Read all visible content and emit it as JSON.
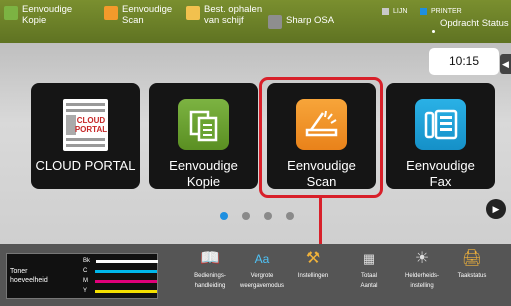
{
  "topbar": {
    "items": [
      {
        "label_l1": "Eenvoudige",
        "label_l2": "Kopie",
        "color": "#7cb342"
      },
      {
        "label_l1": "Eenvoudige",
        "label_l2": "Scan",
        "color": "#f39a2b"
      },
      {
        "label_l1": "Best. ophalen",
        "label_l2": "van schijf",
        "color": "#f2c14e"
      },
      {
        "label_l1": "Sharp OSA",
        "label_l2": "",
        "color": "#8e8e8e"
      }
    ],
    "lijn": "LIJN",
    "printer": "PRINTER",
    "job_status": "Opdracht Status",
    "lijn_color": "#c8c8c8",
    "printer_color": "#1e8fe0"
  },
  "clock": "10:15",
  "tiles": [
    {
      "label_l1": "CLOUD PORTAL",
      "label_l2": "",
      "icon": "cloud-portal-icon",
      "icon_text_l1": "CLOUD",
      "icon_text_l2": "PORTAL"
    },
    {
      "label_l1": "Eenvoudige",
      "label_l2": "Kopie",
      "icon": "copy-icon"
    },
    {
      "label_l1": "Eenvoudige",
      "label_l2": "Scan",
      "icon": "scan-icon"
    },
    {
      "label_l1": "Eenvoudige",
      "label_l2": "Fax",
      "icon": "fax-icon"
    }
  ],
  "pagination": {
    "pages": 4,
    "active": 1
  },
  "bottombar": {
    "toner_label_l1": "Toner",
    "toner_label_l2": "hoeveelheid",
    "toner": [
      {
        "name": "Bk",
        "color": "#ffffff"
      },
      {
        "name": "C",
        "color": "#00b7eb"
      },
      {
        "name": "M",
        "color": "#e0007a"
      },
      {
        "name": "Y",
        "color": "#f5e000"
      }
    ],
    "icons": [
      {
        "label_l1": "Bedienings-",
        "label_l2": "handleiding",
        "icon": "manual-icon"
      },
      {
        "label_l1": "Vergrote",
        "label_l2": "weergavemodus",
        "icon": "zoom-icon"
      },
      {
        "label_l1": "Instellingen",
        "label_l2": "",
        "icon": "settings-icon"
      },
      {
        "label_l1": "Totaal",
        "label_l2": "Aantal",
        "icon": "counter-icon"
      },
      {
        "label_l1": "Helderheids-",
        "label_l2": "instelling",
        "icon": "brightness-icon"
      },
      {
        "label_l1": "Taakstatus",
        "label_l2": "",
        "icon": "job-status-icon"
      }
    ]
  },
  "colors": {
    "highlight": "#d8202a",
    "accent": "#1e8fe0",
    "topbar": "#6b7f28"
  }
}
